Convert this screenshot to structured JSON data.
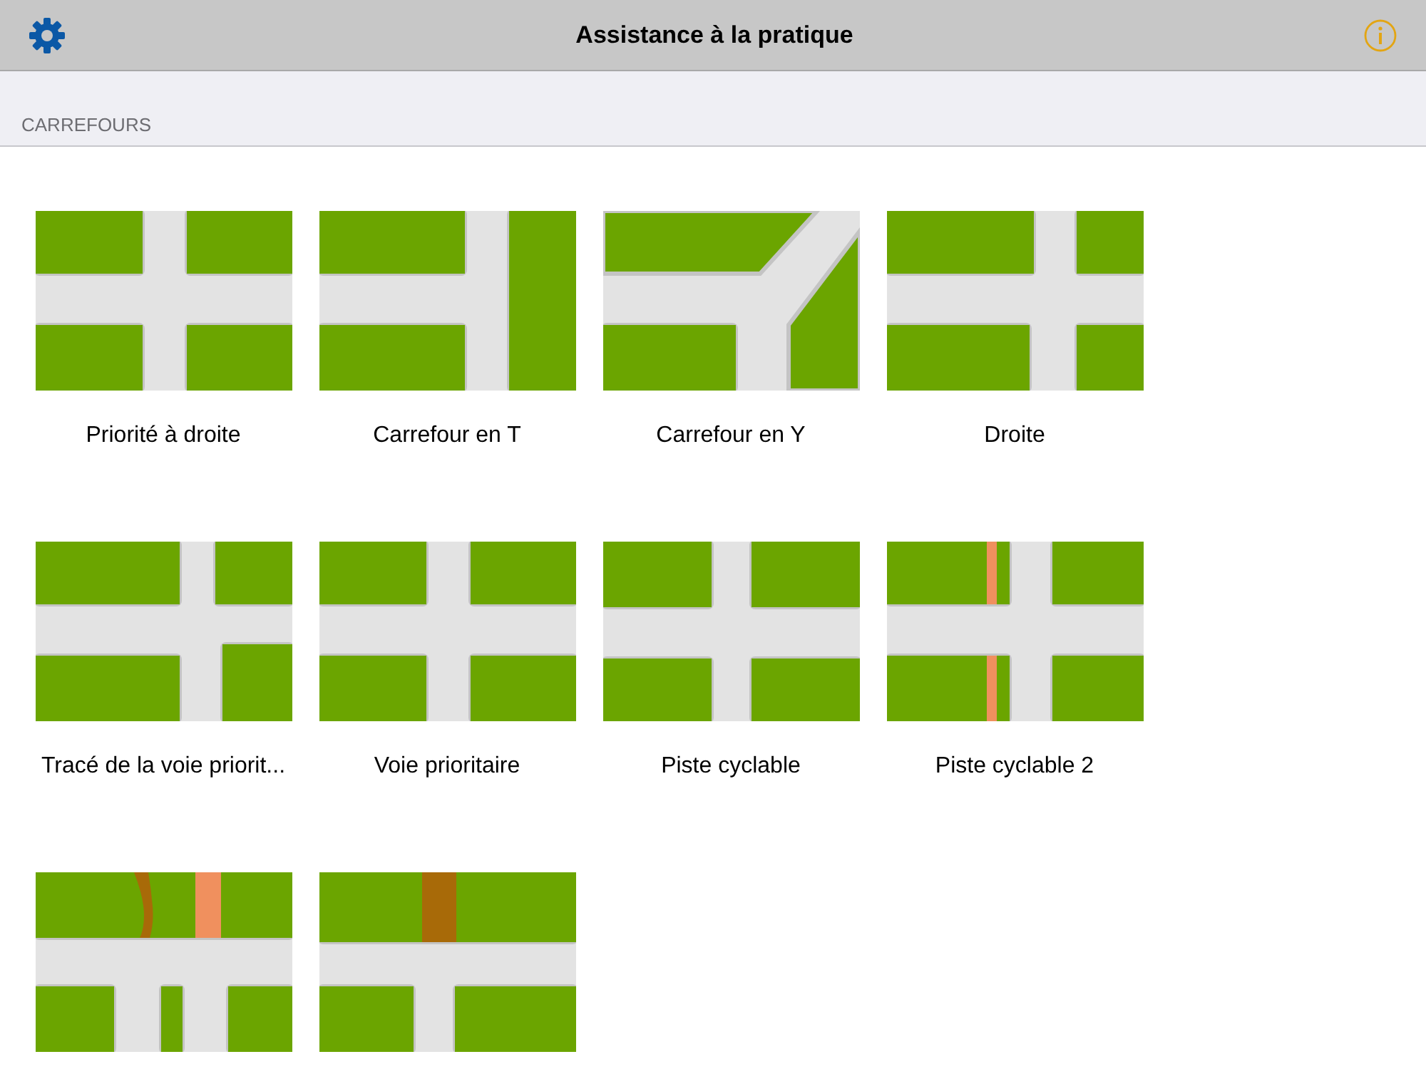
{
  "navigation_bar": {
    "title": "Assistance à la pratique"
  },
  "section": {
    "title": "CARREFOURS"
  },
  "items": [
    {
      "kind": "cross",
      "label": "Priorité à droite"
    },
    {
      "kind": "t-junction",
      "label": "Carrefour en T"
    },
    {
      "kind": "y-junction",
      "label": "Carrefour en Y"
    },
    {
      "kind": "cross-right",
      "label": "Droite"
    },
    {
      "kind": "cross-offset",
      "label": "Tracé de la voie priorit..."
    },
    {
      "kind": "cross",
      "label": "Voie prioritaire"
    },
    {
      "kind": "cross-wide",
      "label": "Piste cyclable"
    },
    {
      "kind": "cross-bike",
      "label": "Piste cyclable 2"
    },
    {
      "kind": "t-bike-lanes"
    },
    {
      "kind": "t-bike-path"
    }
  ]
}
